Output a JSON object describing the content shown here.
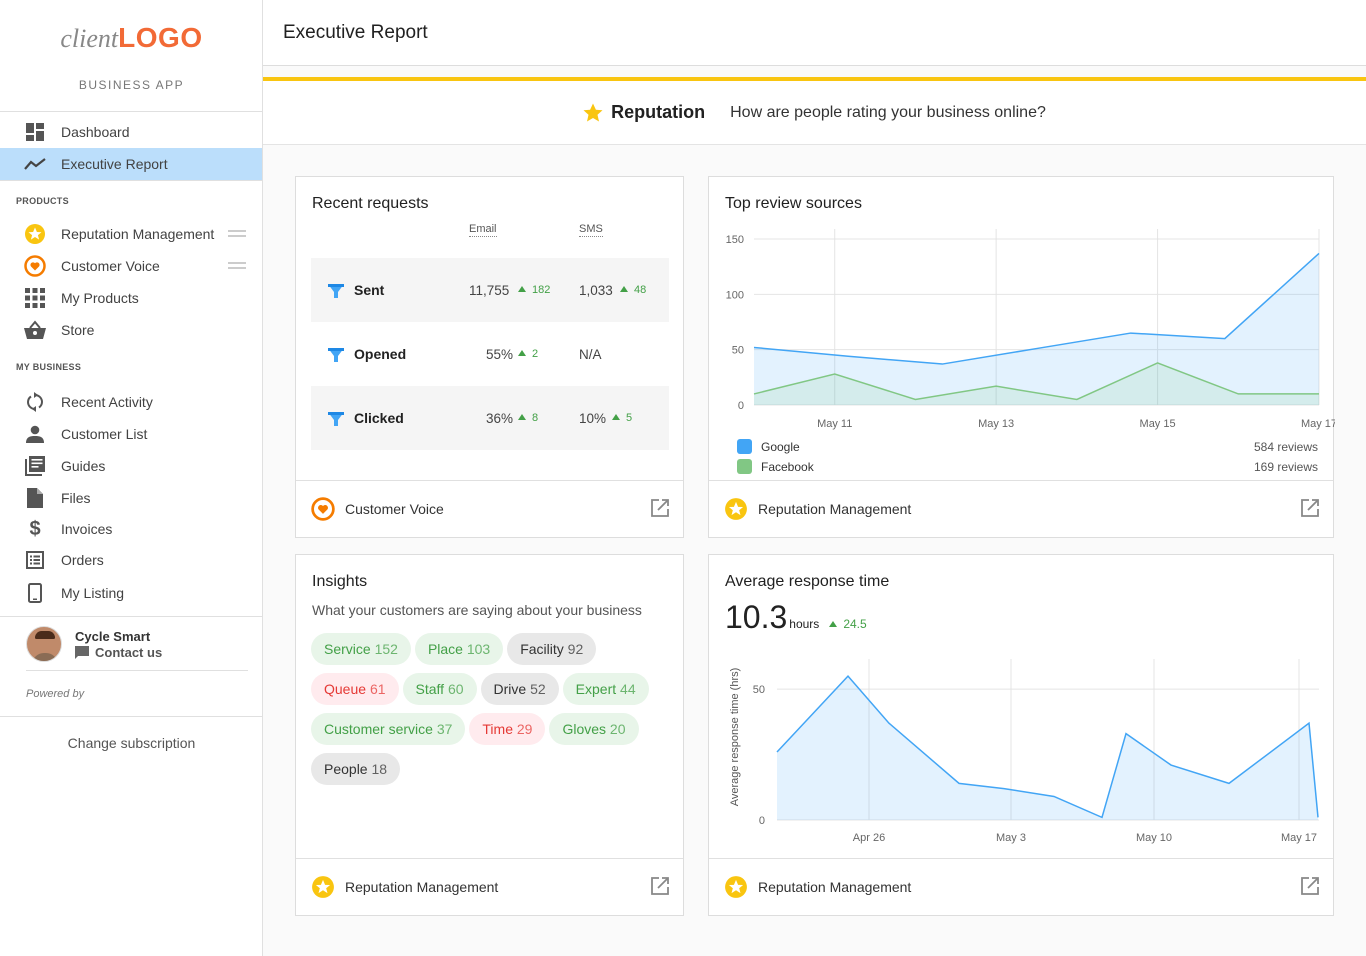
{
  "sidebar": {
    "logo_client": "client",
    "logo_brand": "LOGO",
    "app_label": "BUSINESS APP",
    "nav": [
      {
        "label": "Dashboard",
        "icon": "dashboard-icon"
      },
      {
        "label": "Executive Report",
        "icon": "trending-icon",
        "active": true
      }
    ],
    "products_header": "PRODUCTS",
    "products": [
      {
        "label": "Reputation Management",
        "icon": "star-badge-icon"
      },
      {
        "label": "Customer Voice",
        "icon": "heart-badge-icon"
      },
      {
        "label": "My Products",
        "icon": "grid-icon"
      },
      {
        "label": "Store",
        "icon": "basket-icon"
      }
    ],
    "business_header": "MY BUSINESS",
    "business": [
      {
        "label": "Recent Activity",
        "icon": "refresh-icon"
      },
      {
        "label": "Customer List",
        "icon": "person-icon"
      },
      {
        "label": "Guides",
        "icon": "library-icon"
      },
      {
        "label": "Files",
        "icon": "file-icon"
      },
      {
        "label": "Invoices",
        "icon": "dollar-icon"
      },
      {
        "label": "Orders",
        "icon": "list-icon"
      },
      {
        "label": "My Listing",
        "icon": "phone-icon"
      }
    ],
    "user_name": "Cycle Smart",
    "contact_label": "Contact us",
    "powered_by": "Powered by",
    "change_subscription": "Change subscription"
  },
  "header": {
    "title": "Executive Report"
  },
  "section": {
    "title": "Reputation",
    "question": "How are people rating your business online?"
  },
  "recent_requests": {
    "title": "Recent requests",
    "columns": [
      "Email",
      "SMS"
    ],
    "rows": [
      {
        "label": "Sent",
        "email": "11,755",
        "email_delta": "182",
        "sms": "1,033",
        "sms_delta": "48"
      },
      {
        "label": "Opened",
        "email": "55%",
        "email_delta": "2",
        "sms": "N/A",
        "sms_delta": ""
      },
      {
        "label": "Clicked",
        "email": "36%",
        "email_delta": "8",
        "sms": "10%",
        "sms_delta": "5"
      }
    ],
    "footer": "Customer Voice"
  },
  "top_review_sources": {
    "title": "Top review sources",
    "legend": [
      {
        "name": "Google",
        "color": "#42a5f5",
        "reviews": "584 reviews"
      },
      {
        "name": "Facebook",
        "color": "#81c784",
        "reviews": "169 reviews"
      }
    ],
    "footer": "Reputation Management"
  },
  "insights": {
    "title": "Insights",
    "subtitle": "What your customers are saying about your business",
    "chips": [
      {
        "label": "Service",
        "count": "152",
        "tone": "g"
      },
      {
        "label": "Place",
        "count": "103",
        "tone": "g"
      },
      {
        "label": "Facility",
        "count": "92",
        "tone": "n"
      },
      {
        "label": "Queue",
        "count": "61",
        "tone": "r"
      },
      {
        "label": "Staff",
        "count": "60",
        "tone": "g"
      },
      {
        "label": "Drive",
        "count": "52",
        "tone": "n"
      },
      {
        "label": "Expert",
        "count": "44",
        "tone": "g"
      },
      {
        "label": "Customer service",
        "count": "37",
        "tone": "g"
      },
      {
        "label": "Time",
        "count": "29",
        "tone": "r"
      },
      {
        "label": "Gloves",
        "count": "20",
        "tone": "g"
      },
      {
        "label": "People",
        "count": "18",
        "tone": "n"
      }
    ],
    "footer": "Reputation Management"
  },
  "avg_response": {
    "title": "Average response time",
    "value": "10.3",
    "unit": "hours",
    "delta": "24.5",
    "footer": "Reputation Management"
  },
  "chart_data": [
    {
      "type": "area",
      "title": "Top review sources",
      "x": [
        "May 10",
        "May 11",
        "May 12",
        "May 13",
        "May 14",
        "May 15",
        "May 16",
        "May 17"
      ],
      "x_tick_labels": [
        "May 11",
        "May 13",
        "May 15",
        "May 17"
      ],
      "ylim": [
        0,
        150
      ],
      "y_ticks": [
        0,
        50,
        100,
        150
      ],
      "series": [
        {
          "name": "Google",
          "color": "#42a5f5",
          "values": [
            52,
            44,
            37,
            51,
            65,
            60,
            137
          ]
        },
        {
          "name": "Facebook",
          "color": "#81c784",
          "values": [
            10,
            28,
            5,
            17,
            5,
            38,
            10,
            10
          ]
        }
      ],
      "grid": true
    },
    {
      "type": "area",
      "title": "Average response time",
      "ylabel": "Average response time (hrs)",
      "x_tick_labels": [
        "Apr 26",
        "May 3",
        "May 10",
        "May 17"
      ],
      "ylim": [
        0,
        60
      ],
      "y_ticks": [
        0,
        50
      ],
      "series": [
        {
          "name": "",
          "color": "#42a5f5",
          "values": [
            26,
            55,
            37,
            14,
            12,
            9,
            1,
            33,
            21,
            14,
            37,
            1
          ]
        }
      ],
      "grid": true
    }
  ]
}
